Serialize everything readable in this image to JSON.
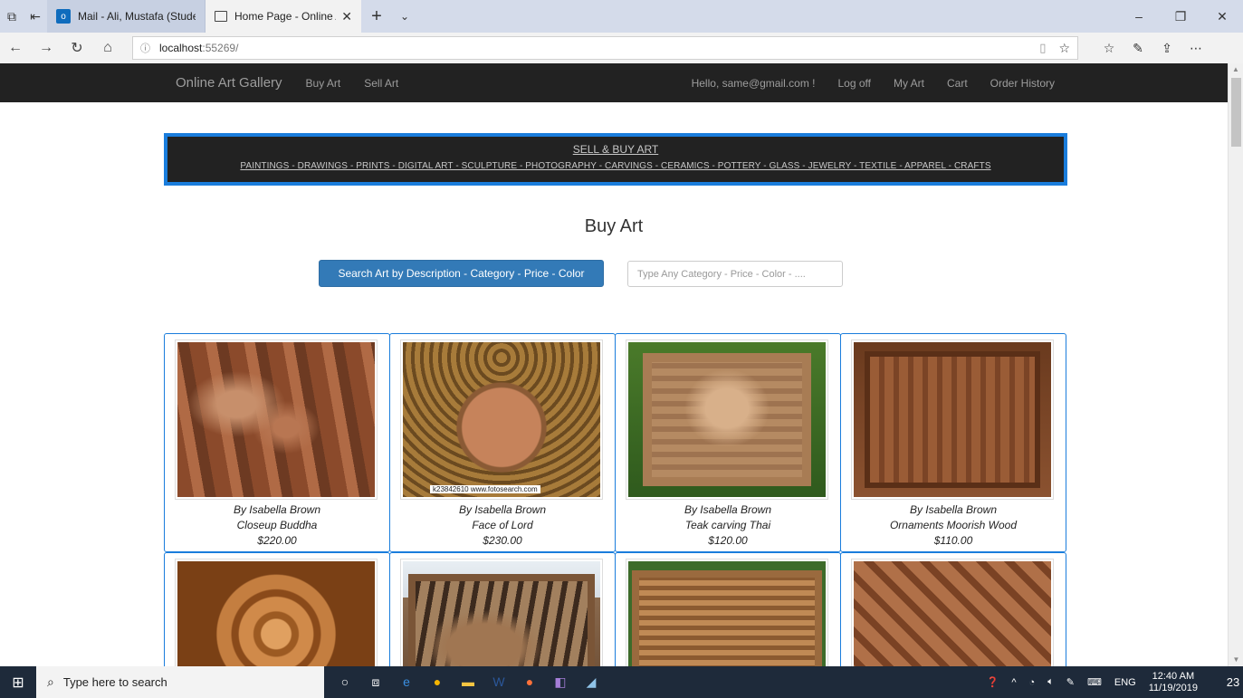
{
  "browser": {
    "tabs": [
      {
        "label": "Mail - Ali, Mustafa (Student)",
        "icon": "outlook-icon",
        "active": false
      },
      {
        "label": "Home Page - Online Art",
        "icon": "page-icon",
        "active": true
      }
    ],
    "url_host": "localhost",
    "url_path": ":55269/"
  },
  "nav": {
    "brand": "Online Art Gallery",
    "left_links": [
      "Buy Art",
      "Sell Art"
    ],
    "greeting": "Hello, same@gmail.com !",
    "right_links": [
      "Log off",
      "My Art",
      "Cart",
      "Order History"
    ]
  },
  "banner": {
    "title": "SELL & BUY ART",
    "categories": "PAINTINGS - DRAWINGS - PRINTS - DIGITAL ART - SCULPTURE - PHOTOGRAPHY - CARVINGS - CERAMICS - POTTERY - GLASS - JEWELRY - TEXTILE - APPAREL - CRAFTS"
  },
  "page": {
    "heading": "Buy Art",
    "search_button": "Search Art by Description - Category - Price - Color",
    "search_placeholder": "Type Any Category - Price - Color - ...."
  },
  "products": [
    {
      "artist": "By Isabella Brown",
      "title": "Closeup Buddha",
      "price": "$220.00"
    },
    {
      "artist": "By Isabella Brown",
      "title": "Face of Lord",
      "price": "$230.00",
      "watermark": "k23842610  www.fotosearch.com"
    },
    {
      "artist": "By Isabella Brown",
      "title": "Teak carving Thai",
      "price": "$120.00"
    },
    {
      "artist": "By Isabella Brown",
      "title": "Ornaments Moorish Wood",
      "price": "$110.00"
    }
  ],
  "taskbar": {
    "search_placeholder": "Type here to search",
    "language": "ENG",
    "time": "12:40 AM",
    "date": "11/19/2019",
    "notifications": "23"
  }
}
